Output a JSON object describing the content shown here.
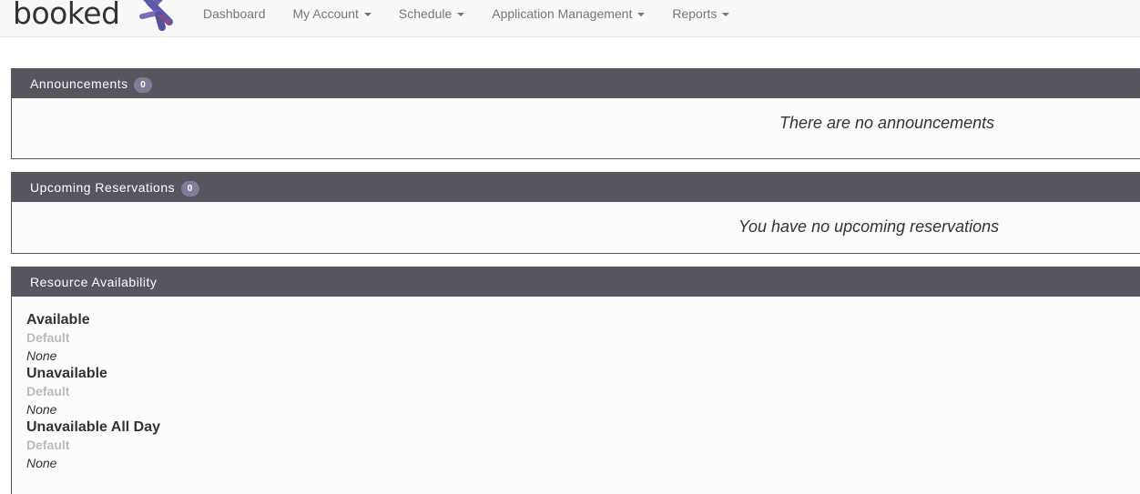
{
  "brand": {
    "name": "booked"
  },
  "nav": {
    "items": [
      {
        "label": "Dashboard",
        "dropdown": false
      },
      {
        "label": "My Account",
        "dropdown": true
      },
      {
        "label": "Schedule",
        "dropdown": true
      },
      {
        "label": "Application Management",
        "dropdown": true
      },
      {
        "label": "Reports",
        "dropdown": true
      }
    ]
  },
  "announcements": {
    "title": "Announcements",
    "count": "0",
    "empty_message": "There are no announcements"
  },
  "reservations": {
    "title": "Upcoming Reservations",
    "count": "0",
    "empty_message": "You have no upcoming reservations"
  },
  "availability": {
    "title": "Resource Availability",
    "groups": [
      {
        "title": "Available",
        "schedule": "Default",
        "value": "None"
      },
      {
        "title": "Unavailable",
        "schedule": "Default",
        "value": "None"
      },
      {
        "title": "Unavailable All Day",
        "schedule": "Default",
        "value": "None"
      }
    ]
  },
  "colors": {
    "panel_header": "#58555f",
    "badge": "#837c96",
    "navbar_bg": "#f8f8f8"
  }
}
